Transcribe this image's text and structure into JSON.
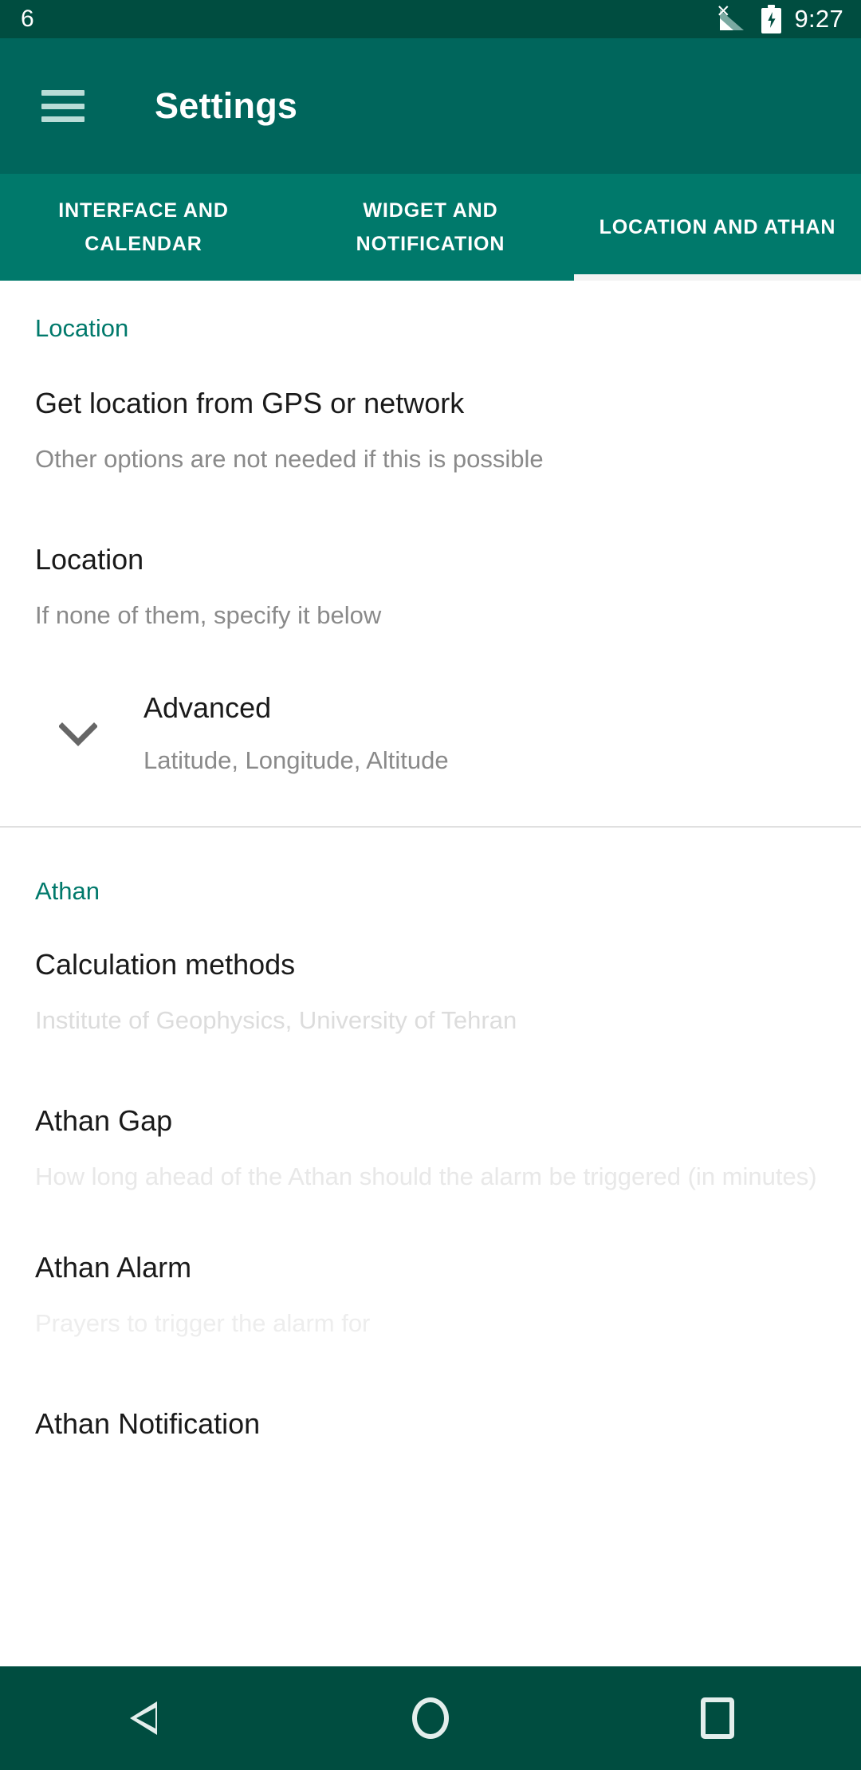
{
  "status_bar": {
    "left_text": "6",
    "clock": "9:27",
    "signal_icon": "signal-no-sim-icon",
    "battery_icon": "battery-charging-icon",
    "background": "#004d40"
  },
  "app_bar": {
    "menu_icon": "hamburger-menu-icon",
    "title": "Settings",
    "background": "#00665c"
  },
  "tabs": {
    "background": "#00796b",
    "active_index": 2,
    "items": [
      {
        "label": "INTERFACE AND CALENDAR"
      },
      {
        "label": "WIDGET AND NOTIFICATION"
      },
      {
        "label": "LOCATION AND ATHAN"
      }
    ]
  },
  "sections": [
    {
      "header": "Location",
      "header_color": "#00796b",
      "items": [
        {
          "title": "Get location from GPS or network",
          "subtitle": "Other options are not needed if this is possible",
          "style": "normal"
        },
        {
          "title": "Location",
          "subtitle": "If none of them, specify it below",
          "style": "normal"
        },
        {
          "title": "Advanced",
          "subtitle": "Latitude, Longitude, Altitude",
          "style": "expandable",
          "icon": "chevron-down-icon"
        }
      ]
    },
    {
      "header": "Athan",
      "header_color": "#00796b",
      "items": [
        {
          "title": "Calculation methods",
          "subtitle": "Institute of Geophysics, University of Tehran",
          "style": "faded1"
        },
        {
          "title": "Athan Gap",
          "subtitle": "How long ahead of the Athan should the alarm be triggered (in minutes)",
          "style": "faded2"
        },
        {
          "title": "Athan Alarm",
          "subtitle": "Prayers to trigger the alarm for",
          "style": "faded3"
        },
        {
          "title": "Athan Notification",
          "subtitle": "",
          "style": "cutoff"
        }
      ]
    }
  ],
  "nav_bar": {
    "background": "#004d40",
    "buttons": [
      {
        "name": "back-icon"
      },
      {
        "name": "home-icon"
      },
      {
        "name": "recents-icon"
      }
    ]
  }
}
